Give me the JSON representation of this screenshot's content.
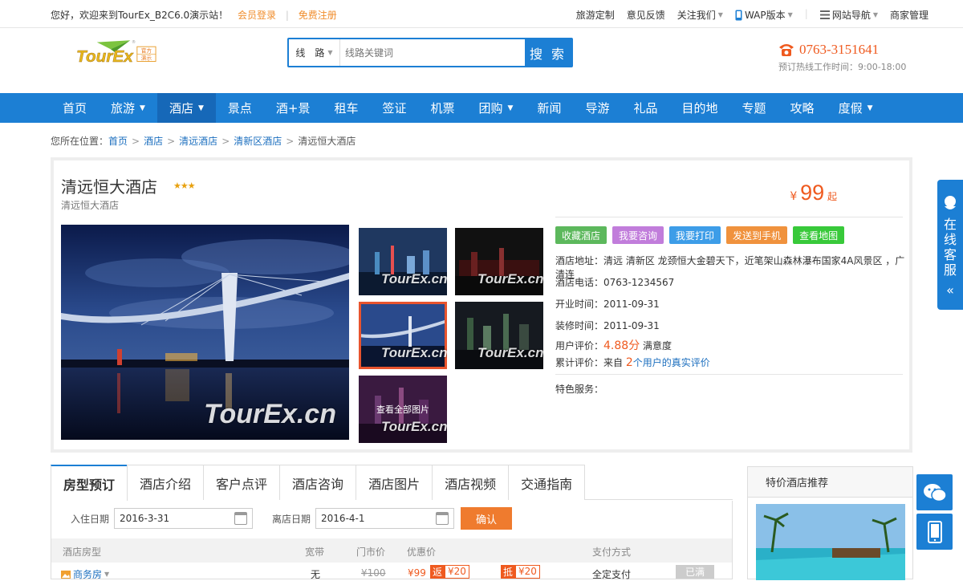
{
  "topbar": {
    "welcome": "您好，欢迎来到TourEx_B2C6.0演示站！",
    "login": "会员登录",
    "sep": "|",
    "register": "免费注册",
    "links": [
      {
        "label": "旅游定制"
      },
      {
        "label": "意见反馈"
      },
      {
        "label": "关注我们"
      },
      {
        "label": "WAP版本"
      },
      {
        "label": "网站导航"
      },
      {
        "label": "商家管理"
      }
    ]
  },
  "logo": {
    "text": "TourEx",
    "badge1": "官方",
    "badge2": "演示"
  },
  "search": {
    "category": "线　路",
    "placeholder": "线路关键词",
    "button": "搜 索"
  },
  "hotline": {
    "phone": "0763-3151641",
    "hours": "预订热线工作时间：9:00-18:00"
  },
  "nav": [
    "首页",
    "旅游",
    "酒店",
    "景点",
    "酒+景",
    "租车",
    "签证",
    "机票",
    "团购",
    "新闻",
    "导游",
    "礼品",
    "目的地",
    "专题",
    "攻略",
    "度假"
  ],
  "breadcrumb": {
    "prefix": "您所在位置：",
    "items": [
      "首页",
      "酒店",
      "清远酒店",
      "清新区酒店"
    ],
    "current": "清远恒大酒店"
  },
  "hotel": {
    "name": "清远恒大酒店",
    "subname": "清远恒大酒店",
    "stars": "★★★",
    "price_currency": "¥",
    "price": "99",
    "price_suffix": "起",
    "watermark": "TourEx.cn",
    "view_all": "查看全部图片",
    "actions": [
      {
        "label": "收藏酒店",
        "color": "#5cb85c"
      },
      {
        "label": "我要咨询",
        "color": "#c17ddb"
      },
      {
        "label": "我要打印",
        "color": "#3d9de8"
      },
      {
        "label": "发送到手机",
        "color": "#f0923d"
      },
      {
        "label": "查看地图",
        "color": "#38c93a"
      }
    ],
    "address": "酒店地址：清远 清新区 龙颈恒大金碧天下，近笔架山森林瀑布国家4A风景区 ，广清连",
    "phone": "酒店电话：0763-1234567",
    "open_time": "开业时间：2011-09-31",
    "renovation": "装修时间：2011-09-31",
    "rating_label": "用户评价：",
    "rating": "4.88分",
    "rating_suffix": " 满意度",
    "reviews_label": "累计评价：来自 ",
    "reviews_count": "2",
    "reviews_suffix": "个用户的真实评价",
    "special": "特色服务："
  },
  "tabs": [
    "房型预订",
    "酒店介绍",
    "客户点评",
    "酒店咨询",
    "酒店图片",
    "酒店视频",
    "交通指南"
  ],
  "booking": {
    "checkin_label": "入住日期",
    "checkin": "2016-3-31",
    "checkout_label": "离店日期",
    "checkout": "2016-4-1",
    "confirm": "确认",
    "headers": [
      "酒店房型",
      "宽带",
      "门市价",
      "优惠价",
      "支付方式"
    ],
    "row": {
      "room": "商务房",
      "broadband": "无",
      "list_price": "¥100",
      "price": "¥99",
      "tag1": "返",
      "tag1_val": "¥20",
      "tag2": "抵",
      "tag2_val": "¥20",
      "payment": "全定支付",
      "status": "已满"
    }
  },
  "side": {
    "title": "特价酒店推荐"
  },
  "kefu": {
    "text": "在线客服",
    "arrow": "«"
  }
}
